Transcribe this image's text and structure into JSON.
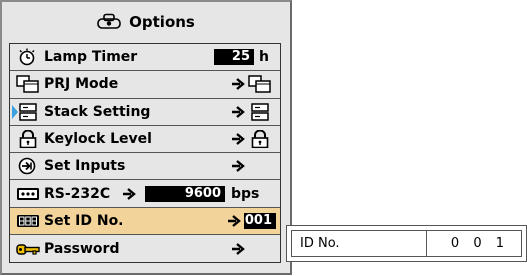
{
  "menu": {
    "title": "Options",
    "items": [
      {
        "label": "Lamp Timer",
        "icon": "lamp-timer-icon",
        "value": "25",
        "unit": "h"
      },
      {
        "label": "PRJ Mode",
        "icon": "projector-mode-icon"
      },
      {
        "label": "Stack Setting",
        "icon": "stack-setting-icon"
      },
      {
        "label": "Keylock Level",
        "icon": "keylock-icon"
      },
      {
        "label": "Set Inputs",
        "icon": "set-inputs-icon"
      },
      {
        "label": "RS-232C",
        "icon": "rs232c-icon",
        "value": "9600",
        "unit": "bps"
      },
      {
        "label": "Set ID No.",
        "icon": "set-id-icon",
        "value": "001",
        "selected": true
      },
      {
        "label": "Password",
        "icon": "key-icon"
      }
    ]
  },
  "side_panel": {
    "label": "ID No.",
    "value": "0 0 1"
  },
  "colors": {
    "menu_background": "#e6e6e6",
    "selected_row": "#f2d49a",
    "value_box": "#000000",
    "accent_cursor": "#3aa0e0"
  }
}
